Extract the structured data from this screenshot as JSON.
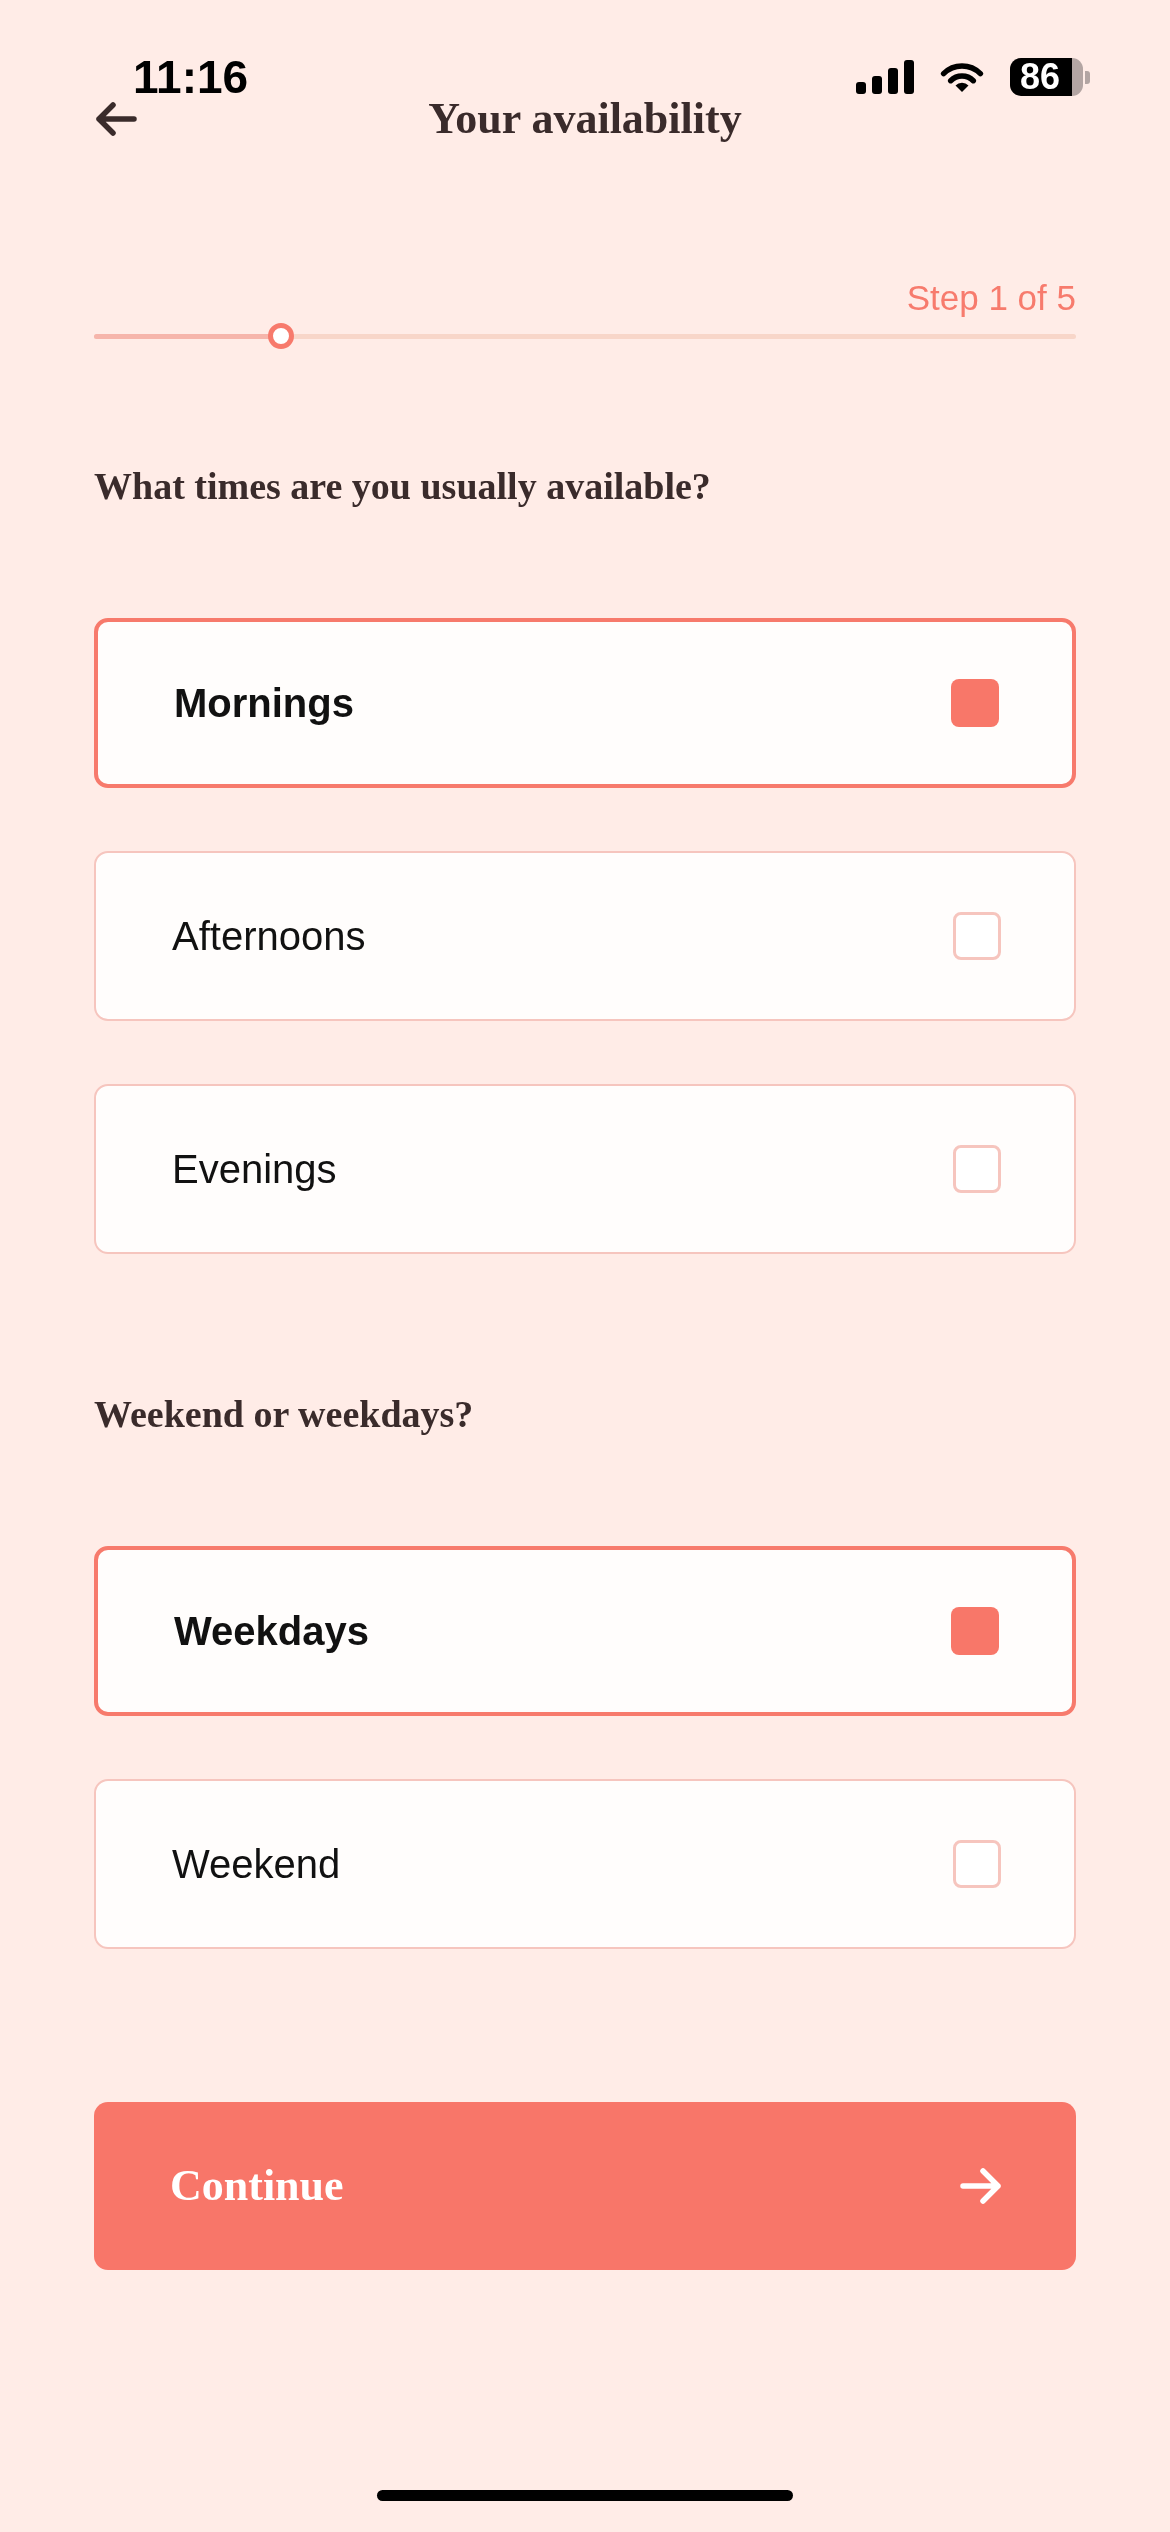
{
  "status_bar": {
    "time": "11:16",
    "battery": "86"
  },
  "header": {
    "title": "Your availability"
  },
  "progress": {
    "label": "Step 1 of 5",
    "level": 0.19
  },
  "sections": [
    {
      "question": "What times are you usually available?",
      "options": [
        {
          "label": "Mornings",
          "checked": true
        },
        {
          "label": "Afternoons",
          "checked": false
        },
        {
          "label": "Evenings",
          "checked": false
        }
      ]
    },
    {
      "question": "Weekend or weekdays?",
      "options": [
        {
          "label": "Weekdays",
          "checked": true
        },
        {
          "label": "Weekend",
          "checked": false
        }
      ]
    }
  ],
  "continue_button": {
    "label": "Continue"
  }
}
